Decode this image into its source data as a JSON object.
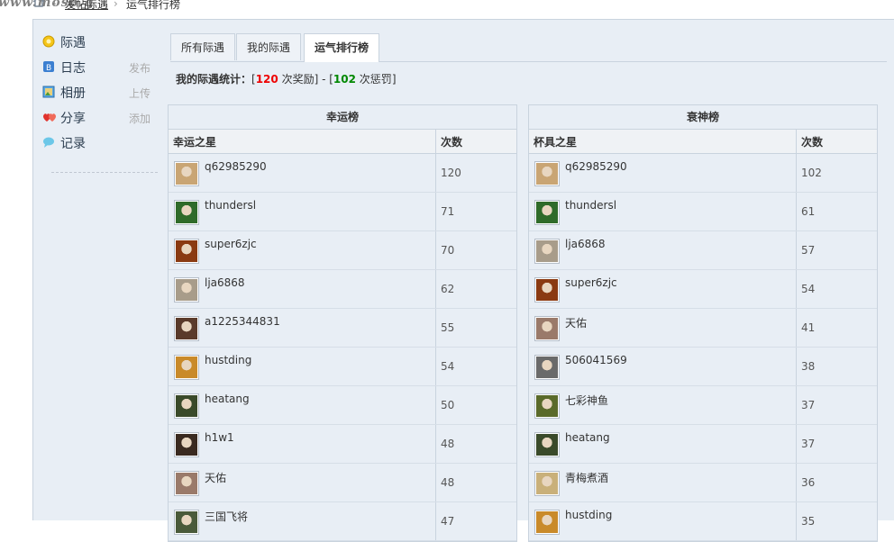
{
  "breadcrumb": {
    "watermark": "www.mosb.g",
    "parent": "发帖际遇",
    "current": "运气排行榜"
  },
  "nav": [
    {
      "label": "际遇",
      "action": "",
      "icon": "encounter-icon"
    },
    {
      "label": "日志",
      "action": "发布",
      "icon": "blog-icon"
    },
    {
      "label": "相册",
      "action": "上传",
      "icon": "album-icon"
    },
    {
      "label": "分享",
      "action": "添加",
      "icon": "share-icon"
    },
    {
      "label": "记录",
      "action": "",
      "icon": "record-icon"
    }
  ],
  "tabs": [
    {
      "label": "所有际遇"
    },
    {
      "label": "我的际遇"
    },
    {
      "label": "运气排行榜"
    }
  ],
  "stats": {
    "label": "我的际遇统计：",
    "reward_count": "120",
    "reward_text": " 次奖励",
    "penalty_count": "102",
    "penalty_text": " 次惩罚"
  },
  "lucky": {
    "title": "幸运榜",
    "col_user": "幸运之星",
    "col_count": "次数",
    "rows": [
      {
        "name": "q62985290",
        "count": "120",
        "avatar": "#c9a574"
      },
      {
        "name": "thundersl",
        "count": "71",
        "avatar": "#2f6b2a"
      },
      {
        "name": "super6zjc",
        "count": "70",
        "avatar": "#8a3a12"
      },
      {
        "name": "lja6868",
        "count": "62",
        "avatar": "#a89c8a"
      },
      {
        "name": "a1225344831",
        "count": "55",
        "avatar": "#5a3a2a"
      },
      {
        "name": "hustding",
        "count": "54",
        "avatar": "#c98a2a"
      },
      {
        "name": "heatang",
        "count": "50",
        "avatar": "#3a4a2a"
      },
      {
        "name": "h1w1",
        "count": "48",
        "avatar": "#3a2a20"
      },
      {
        "name": "天佑",
        "count": "48",
        "avatar": "#9a7a6a"
      },
      {
        "name": "三国飞将",
        "count": "47",
        "avatar": "#4a5a3a"
      }
    ]
  },
  "unlucky": {
    "title": "衰神榜",
    "col_user": "杯具之星",
    "col_count": "次数",
    "rows": [
      {
        "name": "q62985290",
        "count": "102",
        "avatar": "#c9a574"
      },
      {
        "name": "thundersl",
        "count": "61",
        "avatar": "#2f6b2a"
      },
      {
        "name": "lja6868",
        "count": "57",
        "avatar": "#a89c8a"
      },
      {
        "name": "super6zjc",
        "count": "54",
        "avatar": "#8a3a12"
      },
      {
        "name": "天佑",
        "count": "41",
        "avatar": "#9a7a6a"
      },
      {
        "name": "506041569",
        "count": "38",
        "avatar": "#6a6a6a"
      },
      {
        "name": "七彩神鱼",
        "count": "37",
        "avatar": "#5a6a2a"
      },
      {
        "name": "heatang",
        "count": "37",
        "avatar": "#3a4a2a"
      },
      {
        "name": "青梅煮酒",
        "count": "36",
        "avatar": "#c9b07a"
      },
      {
        "name": "hustding",
        "count": "35",
        "avatar": "#c98a2a"
      }
    ]
  }
}
